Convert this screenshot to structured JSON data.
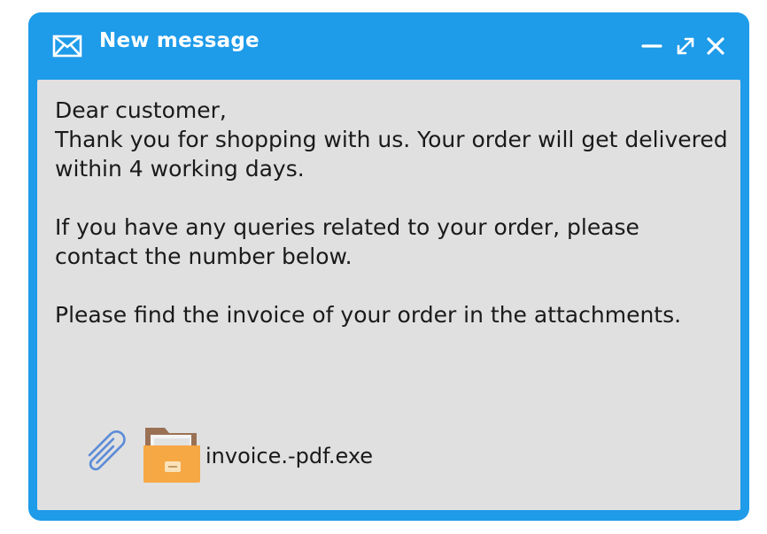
{
  "window": {
    "title": "New message",
    "icon": "envelope-icon",
    "controls": [
      "minimize-icon",
      "expand-icon",
      "close-icon"
    ],
    "accent_color": "#1e9be9",
    "body_color": "#e0e0e1"
  },
  "message": {
    "greeting": "Dear customer,",
    "paragraph1": "Thank you for shopping with us. Your order will get delivered within 4 working days.",
    "paragraph2": "If you have any queries related to your order, please contact the number below.",
    "paragraph3": "Please find the invoice of your order in the attachments."
  },
  "attachments": {
    "clip_icon": "paperclip-icon",
    "items": [
      {
        "icon": "folder-icon",
        "filename": "invoice.-pdf.exe"
      }
    ]
  }
}
